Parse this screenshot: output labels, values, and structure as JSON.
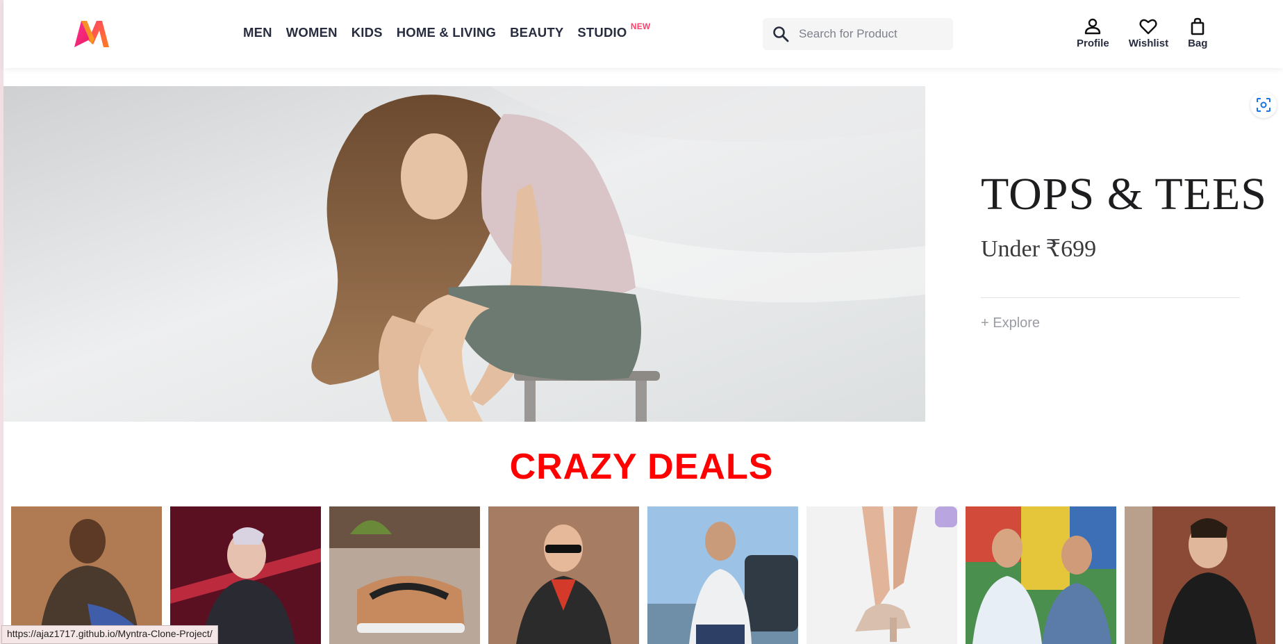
{
  "header": {
    "nav": [
      {
        "label": "MEN"
      },
      {
        "label": "WOMEN"
      },
      {
        "label": "KIDS"
      },
      {
        "label": "HOME & LIVING"
      },
      {
        "label": "BEAUTY"
      },
      {
        "label": "STUDIO",
        "badge": "NEW"
      }
    ],
    "search": {
      "placeholder": "Search for Product"
    },
    "actions": [
      {
        "label": "Profile",
        "icon": "user-icon"
      },
      {
        "label": "Wishlist",
        "icon": "heart-icon"
      },
      {
        "label": "Bag",
        "icon": "bag-icon"
      }
    ],
    "brand_colors": {
      "accent": "#ff3f6c",
      "text": "#282c3f"
    }
  },
  "banner": {
    "title": "TOPS & TEES",
    "subtitle": "Under ₹699",
    "cta": "+ Explore"
  },
  "deals": {
    "title": "CRAZY DEALS",
    "title_color": "#ff0000"
  },
  "status_bar": {
    "url": "https://ajaz1717.github.io/Myntra-Clone-Project/"
  }
}
